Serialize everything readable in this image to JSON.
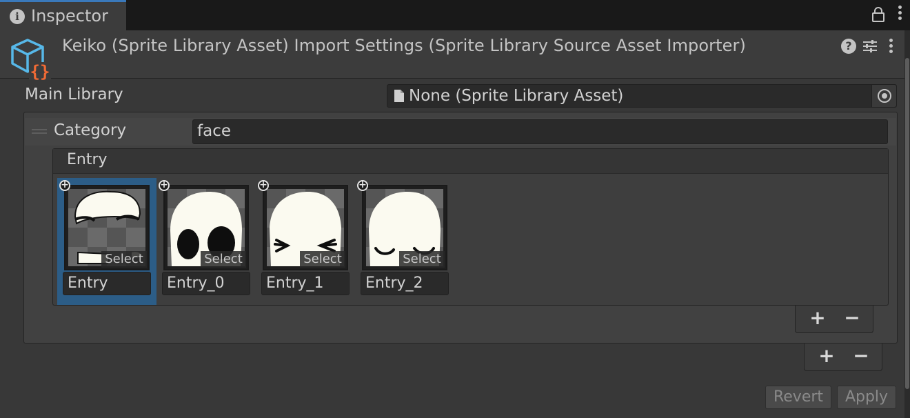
{
  "tab": {
    "label": "Inspector",
    "info_icon": "info-icon"
  },
  "header": {
    "title": "Keiko (Sprite Library Asset) Import Settings (Sprite Library Source Asset Importer)",
    "help_glyph": "?"
  },
  "main_library": {
    "label": "Main Library",
    "value": "None (Sprite Library Asset)"
  },
  "category": {
    "label": "Category",
    "value": "face",
    "entry_header": "Entry",
    "entries": [
      {
        "name": "Entry",
        "badge": "Select",
        "selected": true,
        "sprite": "face-eyebrows"
      },
      {
        "name": "Entry_0",
        "badge": "Select",
        "selected": false,
        "sprite": "face-round-eyes"
      },
      {
        "name": "Entry_1",
        "badge": "Select",
        "selected": false,
        "sprite": "face-squint"
      },
      {
        "name": "Entry_2",
        "badge": "Select",
        "selected": false,
        "sprite": "face-closed-eyes"
      }
    ]
  },
  "list_controls": {
    "add": "+",
    "remove": "−"
  },
  "footer": {
    "revert": "Revert",
    "apply": "Apply"
  },
  "colors": {
    "selection": "#2c5d87",
    "accent_tab": "#3a79bb",
    "asset_icon_blue": "#57b8e8",
    "asset_icon_orange": "#f06a35"
  }
}
